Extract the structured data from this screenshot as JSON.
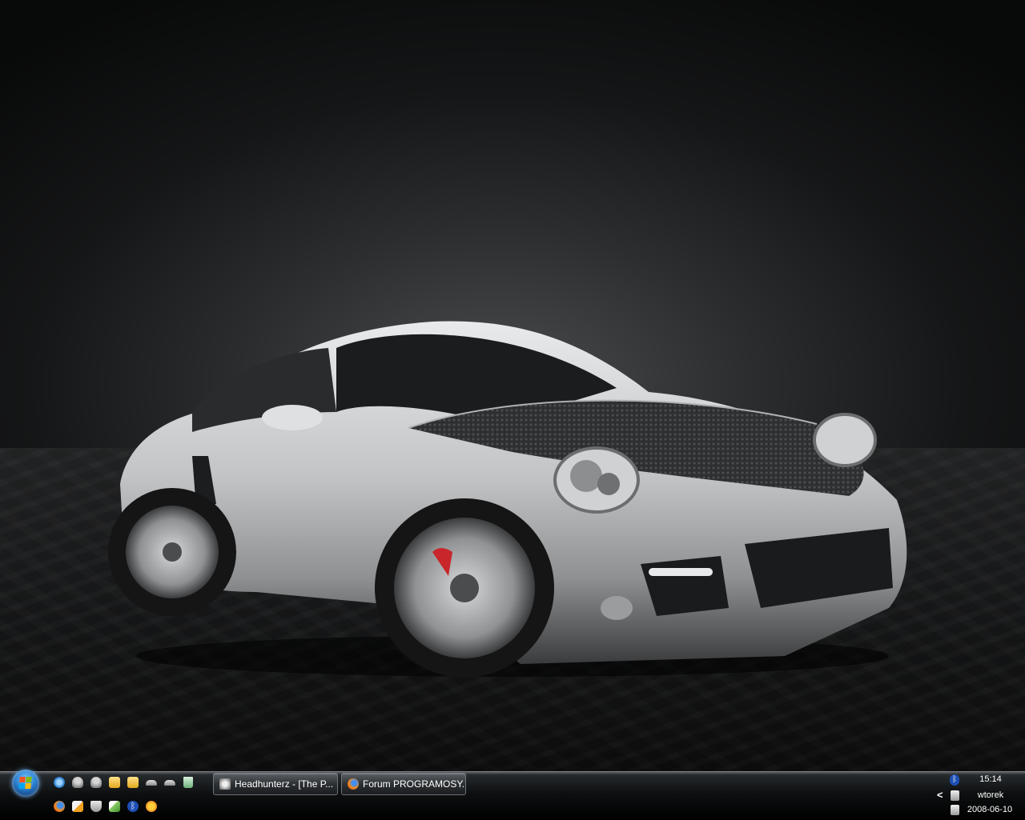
{
  "desktop": {
    "wallpaper": "silver sports coupe on dark background"
  },
  "start_button": {
    "label": "Start",
    "icon": "windows-flag-icon"
  },
  "quick_launch": {
    "row1": [
      "internet-explorer-icon",
      "messenger-user-icon",
      "messenger-user-icon",
      "folder-icon",
      "folder-icon",
      "car-icon",
      "car-icon",
      "recycle-bin-icon"
    ],
    "row2": [
      "firefox-icon",
      "skin-app-icon",
      "shield-icon",
      "notepad-icon",
      "bluetooth-icon",
      "smiley-icon"
    ]
  },
  "taskbar_buttons": [
    {
      "label": "Headhunterz - [The P...",
      "icon": "media-player-icon"
    },
    {
      "label": "Forum PROGRAMOSY...",
      "icon": "firefox-icon"
    }
  ],
  "tray": {
    "expand_label": "<",
    "time": "15:14",
    "day": "wtorek",
    "date": "2008-06-10",
    "icons": [
      "bluetooth-icon",
      "volume-icon",
      "network-icon"
    ]
  },
  "colors": {
    "taskbar": "#0d0f10",
    "start_orb": "#2a7fcf",
    "tray_text": "#ffffff"
  }
}
